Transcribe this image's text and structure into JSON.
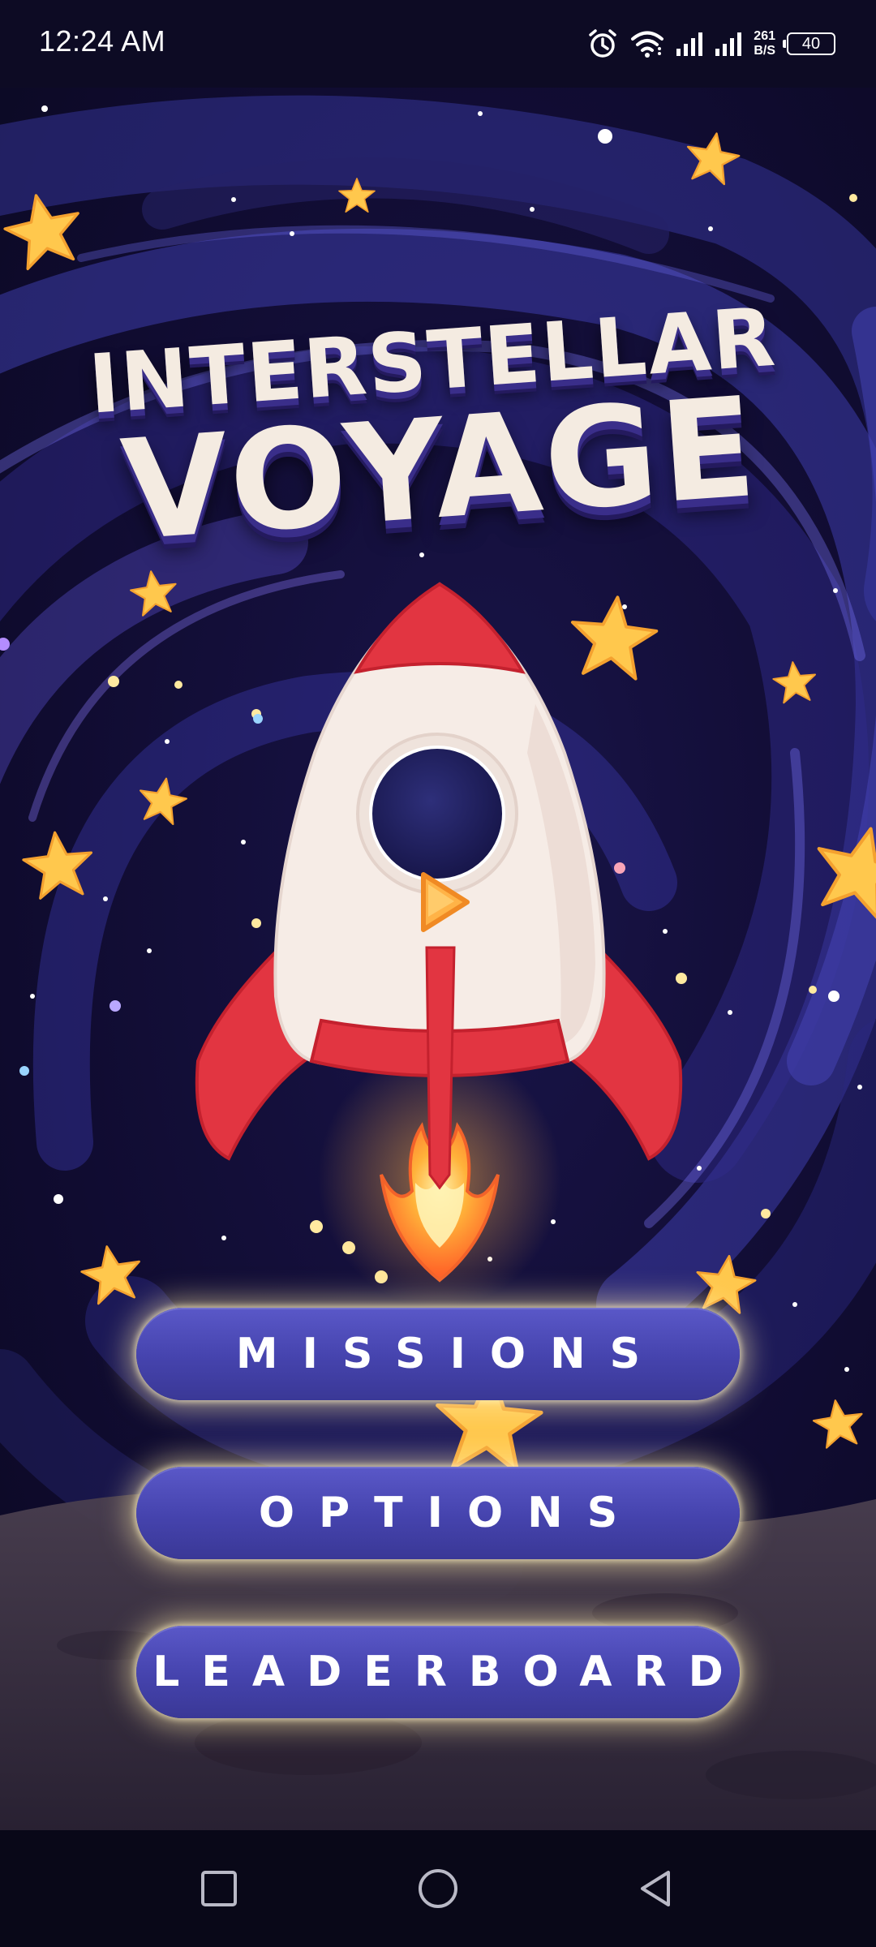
{
  "status_bar": {
    "time": "12:24 AM",
    "net_speed_value": "261",
    "net_speed_unit": "B/S",
    "battery": "40",
    "icons": [
      "alarm-icon",
      "wifi-icon",
      "signal-icon",
      "signal-icon",
      "battery-icon"
    ]
  },
  "game": {
    "title_line1": "INTERSTELLAR",
    "title_line2": "VOYAGE",
    "play_icon": "play-icon"
  },
  "menu": {
    "missions_label": "MISSIONS",
    "options_label": "OPTIONS",
    "leaderboard_label": "LEADERBOARD"
  },
  "nav_bar": {
    "icons": [
      "recents-square-icon",
      "home-circle-icon",
      "back-triangle-icon"
    ]
  },
  "colors": {
    "background": "#0b0a22",
    "button": "#4a48b4",
    "button_glow": "#ffecaa",
    "rocket_red": "#e8343f",
    "rocket_body": "#f6ece6",
    "star": "#ffc34a",
    "title": "#f4ebe1"
  }
}
